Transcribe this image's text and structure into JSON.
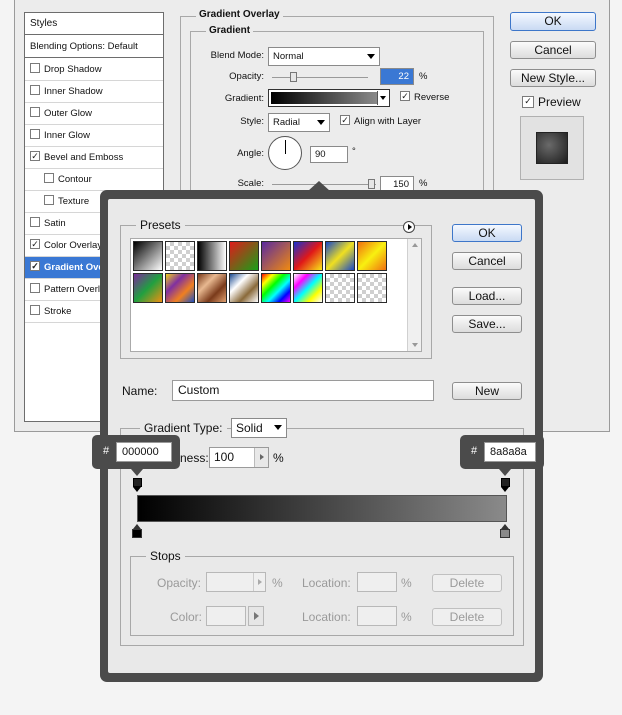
{
  "styles_panel": {
    "title": "Styles",
    "blending": "Blending Options: Default",
    "items": [
      {
        "label": "Drop Shadow",
        "checked": false,
        "selected": false
      },
      {
        "label": "Inner Shadow",
        "checked": false,
        "selected": false
      },
      {
        "label": "Outer Glow",
        "checked": false,
        "selected": false
      },
      {
        "label": "Inner Glow",
        "checked": false,
        "selected": false
      },
      {
        "label": "Bevel and Emboss",
        "checked": true,
        "selected": false
      },
      {
        "label": "Contour",
        "checked": false,
        "selected": false
      },
      {
        "label": "Texture",
        "checked": false,
        "selected": false
      },
      {
        "label": "Satin",
        "checked": false,
        "selected": false
      },
      {
        "label": "Color Overlay",
        "checked": true,
        "selected": false
      },
      {
        "label": "Gradient Overlay",
        "checked": true,
        "selected": true
      },
      {
        "label": "Pattern Overlay",
        "checked": false,
        "selected": false
      },
      {
        "label": "Stroke",
        "checked": false,
        "selected": false
      }
    ]
  },
  "gradient_overlay": {
    "section_title": "Gradient Overlay",
    "group_title": "Gradient",
    "blend_mode_label": "Blend Mode:",
    "blend_mode_value": "Normal",
    "opacity_label": "Opacity:",
    "opacity_value": "22",
    "opacity_unit": "%",
    "opacity_fraction": 0.22,
    "gradient_label": "Gradient:",
    "reverse_label": "Reverse",
    "reverse_checked": true,
    "style_label": "Style:",
    "style_value": "Radial",
    "align_label": "Align with Layer",
    "align_checked": true,
    "angle_label": "Angle:",
    "angle_value": "90",
    "angle_unit": "°",
    "scale_label": "Scale:",
    "scale_value": "150",
    "scale_unit": "%",
    "scale_fraction": 0.95
  },
  "dialog_buttons": {
    "ok": "OK",
    "cancel": "Cancel",
    "new_style": "New Style...",
    "preview_label": "Preview",
    "preview_checked": true
  },
  "gradient_editor": {
    "presets_label": "Presets",
    "buttons": {
      "ok": "OK",
      "cancel": "Cancel",
      "load": "Load...",
      "save": "Save..."
    },
    "name_label": "Name:",
    "name_value": "Custom",
    "new_button": "New",
    "gradient_type_label": "Gradient Type:",
    "gradient_type_value": "Solid",
    "smoothness_label": "ness:",
    "smoothness_value": "100",
    "smoothness_unit": "%",
    "stops_label": "Stops",
    "stops": {
      "opacity_label": "Opacity:",
      "opacity_unit": "%",
      "location_label_1": "Location:",
      "location_unit_1": "%",
      "delete_1": "Delete",
      "color_label": "Color:",
      "location_label_2": "Location:",
      "location_unit_2": "%",
      "delete_2": "Delete"
    },
    "start_color": "#000000",
    "end_color": "#8a8a8a",
    "presets": [
      {
        "name": "black-white",
        "css": "linear-gradient(135deg,#000,#fff)"
      },
      {
        "name": "black-transparent",
        "css": "checker"
      },
      {
        "name": "black-white-2",
        "css": "linear-gradient(90deg,#000,#fff)"
      },
      {
        "name": "red-green",
        "css": "linear-gradient(135deg,#e01a1a,#18a018)"
      },
      {
        "name": "violet-orange",
        "css": "linear-gradient(135deg,#5a2aa0,#f08a10)"
      },
      {
        "name": "blue-red-yellow",
        "css": "linear-gradient(135deg,#1830d0,#e01818,#f8e818)"
      },
      {
        "name": "blue-yellow-blue",
        "css": "linear-gradient(135deg,#1848c8,#f0e020,#1848c8)"
      },
      {
        "name": "orange-yellow-orange",
        "css": "linear-gradient(135deg,#f07010,#f8f010,#f07010)"
      },
      {
        "name": "violet-green-orange",
        "css": "linear-gradient(135deg,#7a2a9a,#20a040,#f09010)"
      },
      {
        "name": "yellow-violet-orange-blue",
        "css": "linear-gradient(135deg,#f0d020,#8030a0,#f08020,#2050c0)"
      },
      {
        "name": "copper",
        "css": "linear-gradient(135deg,#7a3a1a,#e8b890,#7a3a1a,#e0a070)"
      },
      {
        "name": "chrome",
        "css": "linear-gradient(135deg,#1a4a90,#fff,#8a6a3a,#fff)"
      },
      {
        "name": "spectrum",
        "css": "linear-gradient(135deg,#f00,#ff0,#0f0,#0ff,#00f,#f0f)"
      },
      {
        "name": "transparent-rainbow",
        "css": "linear-gradient(135deg,#fff,#f0f,#0ff,#ff0,#fff)"
      },
      {
        "name": "transparent-stripes",
        "css": "checker"
      },
      {
        "name": "neutral-density",
        "css": "checker"
      }
    ]
  }
}
